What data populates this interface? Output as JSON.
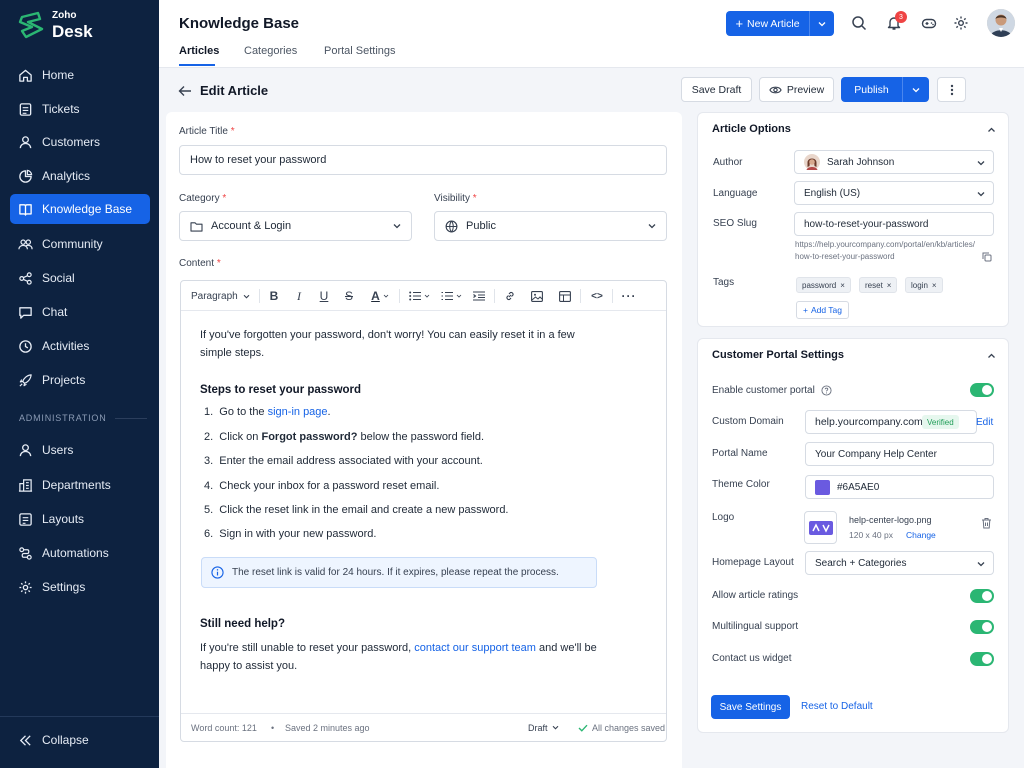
{
  "sidebar": {
    "brand_top": "Zoho",
    "brand_bottom": "Desk",
    "items": [
      {
        "label": "Home",
        "icon": "home-icon"
      },
      {
        "label": "Tickets",
        "icon": "ticket-icon"
      },
      {
        "label": "Customers",
        "icon": "user-icon"
      },
      {
        "label": "Analytics",
        "icon": "analytics-icon"
      },
      {
        "label": "Knowledge Base",
        "icon": "book-icon",
        "active": true
      },
      {
        "label": "Community",
        "icon": "community-icon"
      },
      {
        "label": "Social",
        "icon": "share-icon"
      },
      {
        "label": "Chat",
        "icon": "chat-icon"
      },
      {
        "label": "Activities",
        "icon": "clock-icon"
      },
      {
        "label": "Projects",
        "icon": "rocket-icon"
      }
    ],
    "admin_section": "ADMINISTRATION",
    "admin_items": [
      {
        "label": "Users",
        "icon": "user-icon"
      },
      {
        "label": "Departments",
        "icon": "building-icon"
      },
      {
        "label": "Layouts",
        "icon": "layout-icon"
      },
      {
        "label": "Automations",
        "icon": "automation-icon"
      },
      {
        "label": "Settings",
        "icon": "gear-icon"
      }
    ],
    "collapse_label": "Collapse"
  },
  "header": {
    "title": "Knowledge Base",
    "tabs": [
      "Articles",
      "Categories",
      "Portal Settings"
    ],
    "new_article": "New Article",
    "notification_count": "3"
  },
  "editbar": {
    "title": "Edit Article",
    "save_draft": "Save Draft",
    "preview": "Preview",
    "publish": "Publish"
  },
  "form": {
    "title_label": "Article Title",
    "title_value": "How to reset your password",
    "category_label": "Category",
    "category_value": "Account & Login",
    "visibility_label": "Visibility",
    "visibility_value": "Public",
    "content_label": "Content",
    "paragraph_style": "Paragraph"
  },
  "content": {
    "intro_1": "If you've forgotten your password, don't worry! You can easily reset it in a few",
    "intro_2": "simple steps.",
    "steps_heading": "Steps to reset your password",
    "step1_pre": "Go to the ",
    "step1_link": "sign-in page",
    "step1_post": ".",
    "step2_pre": "Click on ",
    "step2_bold": "Forgot password?",
    "step2_post": " below the password field.",
    "step3": "Enter the email address associated with your account.",
    "step4": "Check your inbox for a password reset email.",
    "step5": "Click the reset link in the email and create a new password.",
    "step6": "Sign in with your new password.",
    "note": "The reset link is valid for 24 hours. If it expires, please repeat the process.",
    "help_heading": "Still need help?",
    "help_pre": "If you're still unable to reset your password, ",
    "help_link": "contact our support team",
    "help_post": " and we'll be",
    "help_2": "happy to assist you."
  },
  "footer": {
    "word_count": "Word count: 121",
    "saved": "Saved 2 minutes ago",
    "status": "Draft",
    "changes": "All changes saved"
  },
  "article_options": {
    "title": "Article Options",
    "author_label": "Author",
    "author_value": "Sarah Johnson",
    "language_label": "Language",
    "language_value": "English (US)",
    "slug_label": "SEO Slug",
    "slug_value": "how-to-reset-your-password",
    "slug_url_1": "https://help.yourcompany.com/portal/en/kb/articles/",
    "slug_url_2": "how-to-reset-your-password",
    "tags_label": "Tags",
    "tags": [
      "password",
      "reset",
      "login"
    ],
    "add_tag": "Add Tag"
  },
  "portal": {
    "title": "Customer Portal Settings",
    "enable_label": "Enable customer portal",
    "enable_on": true,
    "domain_label": "Custom Domain",
    "domain_value": "help.yourcompany.com",
    "domain_status": "Verified",
    "domain_edit": "Edit",
    "name_label": "Portal Name",
    "name_value": "Your Company Help Center",
    "theme_label": "Theme Color",
    "theme_value": "#6A5AE0",
    "logo_label": "Logo",
    "logo_file": "help-center-logo.png",
    "logo_size": "120 x 40 px",
    "logo_change": "Change",
    "layout_label": "Homepage Layout",
    "layout_value": "Search + Categories",
    "ratings_label": "Allow article ratings",
    "ratings_on": true,
    "multilingual_label": "Multilingual support",
    "multilingual_on": true,
    "contact_label": "Contact us widget",
    "contact_on": true,
    "save": "Save Settings",
    "reset": "Reset to Default"
  },
  "colors": {
    "sidebar_bg": "#0d2240",
    "accent": "#1663e6",
    "toggle_on": "#2bb673",
    "verified": "#1f9d57"
  }
}
